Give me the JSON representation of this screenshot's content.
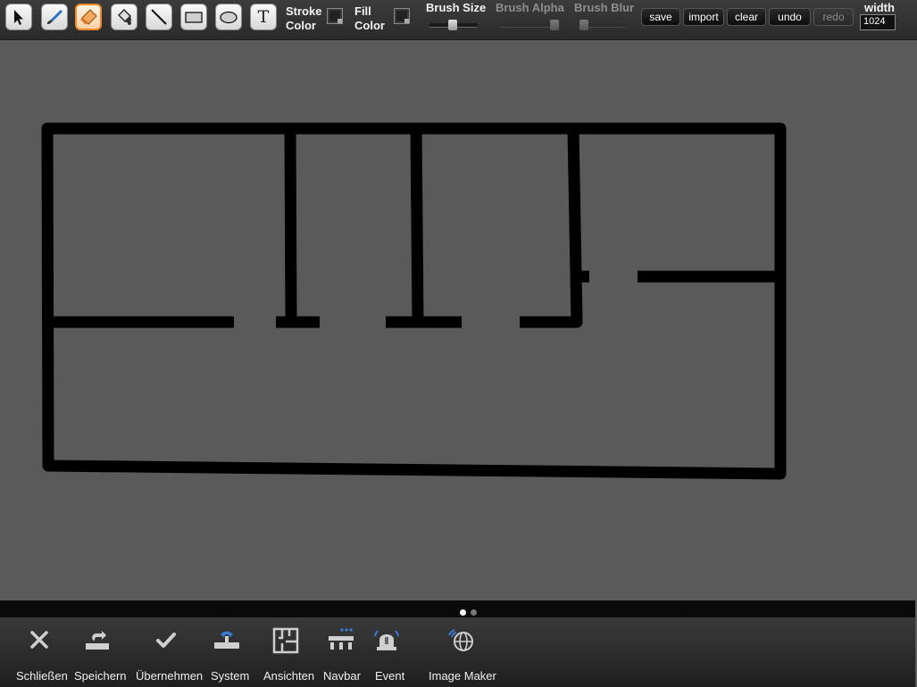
{
  "toolbar": {
    "tools": [
      {
        "name": "select-tool",
        "icon": "arrow-cursor-icon"
      },
      {
        "name": "brush-tool",
        "icon": "brush-icon"
      },
      {
        "name": "eraser-tool",
        "icon": "eraser-icon",
        "active": true
      },
      {
        "name": "fill-tool",
        "icon": "paint-bucket-icon"
      },
      {
        "name": "line-tool",
        "icon": "line-icon"
      },
      {
        "name": "rectangle-tool",
        "icon": "rectangle-icon"
      },
      {
        "name": "ellipse-tool",
        "icon": "ellipse-icon"
      },
      {
        "name": "text-tool",
        "icon": "text-icon",
        "glyph": "T"
      }
    ],
    "stroke_color_line1": "Stroke",
    "stroke_color_line2": "Color",
    "fill_color_line1": "Fill",
    "fill_color_line2": "Color",
    "brush_size_label": "Brush Size",
    "brush_alpha_label": "Brush Alpha",
    "brush_blur_label": "Brush Blur",
    "buttons": {
      "save": "save",
      "import": "import",
      "clear": "clear",
      "undo": "undo",
      "redo": "redo"
    },
    "width_label": "width",
    "width_value": "1024"
  },
  "pager": {
    "pages": 2,
    "current": 1
  },
  "bottom_bar": {
    "items": [
      {
        "label": "Schließen",
        "icon": "close-icon"
      },
      {
        "label": "Speichern",
        "icon": "save-icon"
      },
      {
        "label": "Übernehmen",
        "icon": "checkmark-icon"
      },
      {
        "label": "System",
        "icon": "system-icon"
      },
      {
        "label": "Ansichten",
        "icon": "floorplan-icon"
      },
      {
        "label": "Navbar",
        "icon": "navbar-icon"
      },
      {
        "label": "Event",
        "icon": "siren-icon"
      },
      {
        "label": "Image Maker",
        "icon": "globe-icon"
      }
    ]
  },
  "colors": {
    "canvas_background": "#5a5a5a",
    "stroke": "#000000",
    "active_tool_border": "#f08a2a"
  }
}
